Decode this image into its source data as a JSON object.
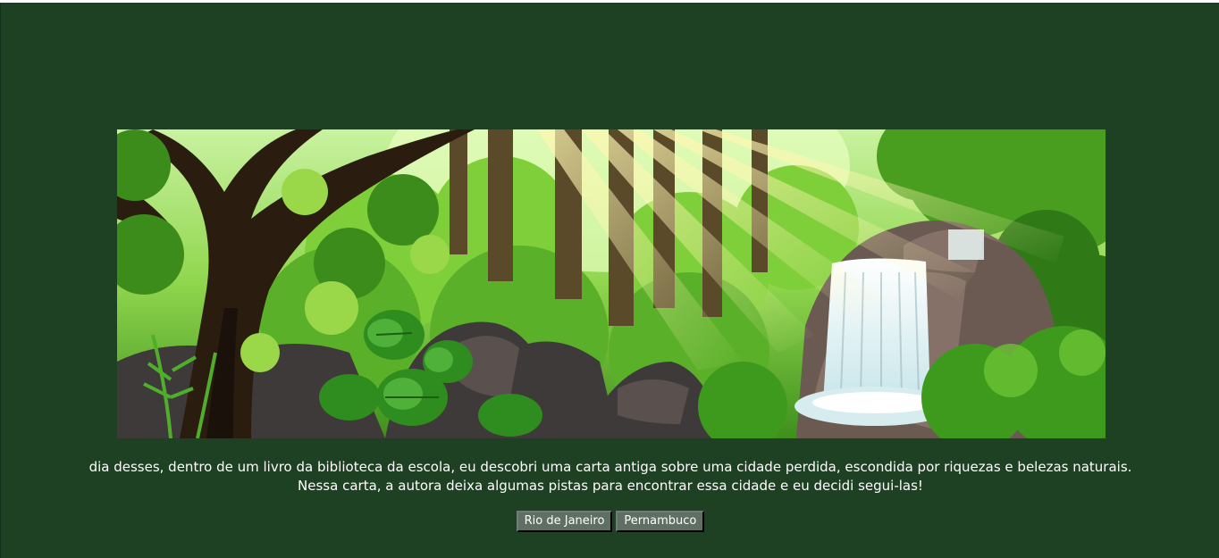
{
  "story": {
    "line1": "dia desses, dentro de um livro da biblioteca da escola, eu descobri uma carta antiga sobre uma cidade perdida, escondida por riquezas e belezas naturais.",
    "line2": "Nessa carta, a autora deixa algumas pistas para encontrar essa cidade e eu decidi segui-las!"
  },
  "choices": [
    {
      "label": "Rio de Janeiro"
    },
    {
      "label": "Pernambuco"
    }
  ],
  "colors": {
    "background": "#1e4023",
    "button": "#5f6f63"
  }
}
